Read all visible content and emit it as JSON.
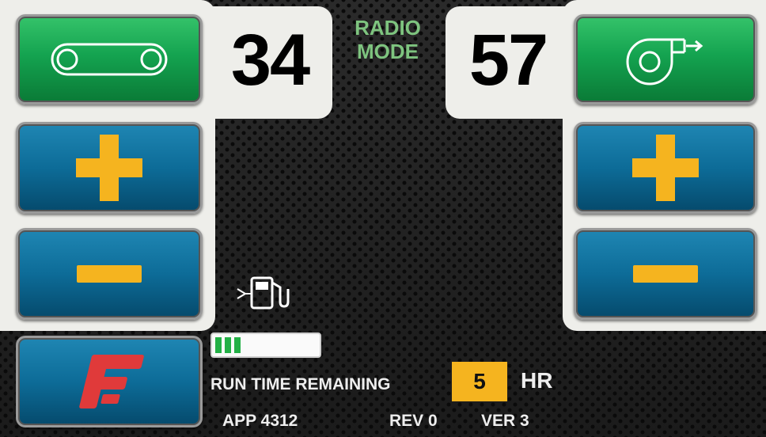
{
  "left": {
    "value": "34",
    "mode_button_icon": "conveyor-belt-icon",
    "increase_icon": "plus-icon",
    "decrease_icon": "minus-icon"
  },
  "right": {
    "value": "57",
    "mode_button_icon": "blower-fan-icon",
    "increase_icon": "plus-icon",
    "decrease_icon": "minus-icon"
  },
  "mode": {
    "line1": "RADIO",
    "line2": "MODE"
  },
  "fuel": {
    "icon": "fuel-pump-icon",
    "level_fraction": 0.25,
    "segments_lit": 3
  },
  "brand_icon": "f-logo-icon",
  "runtime": {
    "label": "RUN TIME REMAINING",
    "value": "5",
    "unit": "HR"
  },
  "footer": {
    "app": "APP  4312",
    "rev": "REV 0",
    "ver": "VER 3"
  },
  "colors": {
    "panel": "#eeeeea",
    "green_button": "#14a350",
    "blue_button": "#0d6c98",
    "accent_yellow": "#f5b41f",
    "mode_text": "#7ec47f",
    "fuel_green": "#23b046",
    "logo_red": "#e03a3a"
  }
}
